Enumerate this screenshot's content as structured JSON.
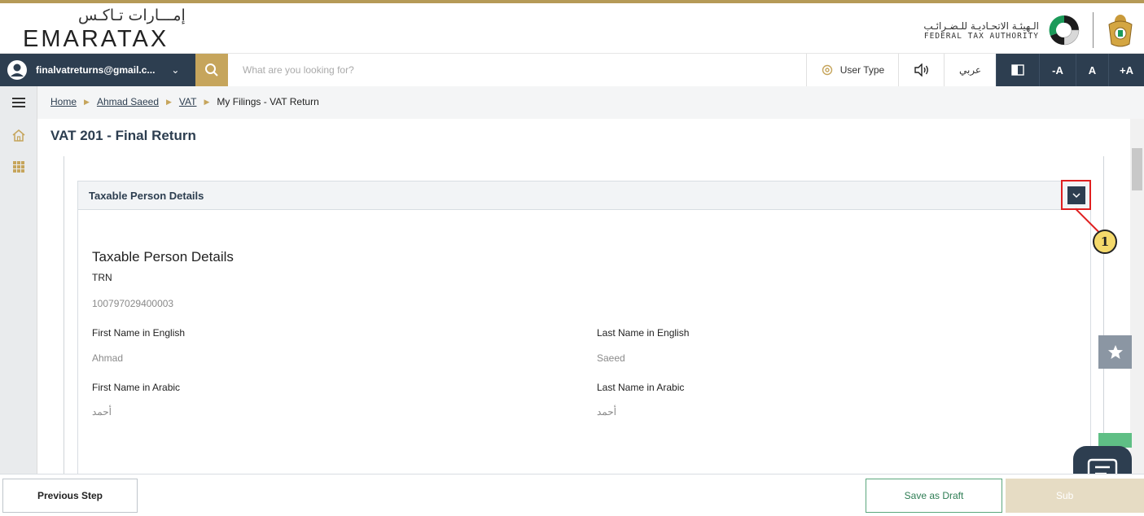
{
  "header": {
    "logo_arabic": "إمـــارات تـاكـس",
    "logo_english": "EMARATAX",
    "authority_arabic": "الـهيئـة الاتحـاديـة للـضـرائـب",
    "authority_english": "FEDERAL TAX AUTHORITY"
  },
  "nav": {
    "user_email": "finalvatreturns@gmail.c...",
    "search_placeholder": "What are you looking for?",
    "user_type_label": "User Type",
    "language_label": "عربي",
    "font_decrease": "-A",
    "font_normal": "A",
    "font_increase": "+A"
  },
  "breadcrumb": {
    "home": "Home",
    "taxpayer": "Ahmad Saeed",
    "vat": "VAT",
    "current": "My Filings - VAT Return"
  },
  "page": {
    "title": "VAT 201 - Final Return"
  },
  "section": {
    "header_title": "Taxable Person Details",
    "body_title": "Taxable Person Details",
    "annotation_number": "1",
    "fields": {
      "trn_label": "TRN",
      "trn_value": "100797029400003",
      "first_name_en_label": "First Name in English",
      "first_name_en_value": "Ahmad",
      "last_name_en_label": "Last Name in English",
      "last_name_en_value": "Saeed",
      "first_name_ar_label": "First Name in Arabic",
      "first_name_ar_value": "أحمد",
      "last_name_ar_label": "Last Name in Arabic",
      "last_name_ar_value": "أحمد"
    }
  },
  "footer": {
    "previous_label": "Previous Step",
    "draft_label": "Save as Draft",
    "submit_label": "Sub"
  },
  "colors": {
    "navy": "#2d3e50",
    "gold": "#c6a55c",
    "annotation_red": "#e02020",
    "draft_green": "#2e7d54"
  }
}
